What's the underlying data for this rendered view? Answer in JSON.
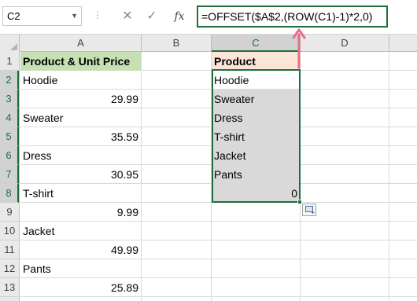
{
  "formula_bar": {
    "name_box": "C2",
    "cancel_icon": "close-icon",
    "enter_icon": "check-icon",
    "function_label": "fx",
    "formula": "=OFFSET($A$2,(ROW(C1)-1)*2,0)"
  },
  "columns": [
    "A",
    "B",
    "C",
    "D"
  ],
  "rows": [
    "1",
    "2",
    "3",
    "4",
    "5",
    "6",
    "7",
    "8",
    "9",
    "10",
    "11",
    "12",
    "13"
  ],
  "sheet": {
    "A": [
      "Product & Unit Price",
      "Hoodie",
      "29.99",
      "Sweater",
      "35.59",
      "Dress",
      "30.95",
      "T-shirt",
      "9.99",
      "Jacket",
      "49.99",
      "Pants",
      "25.89"
    ],
    "C": [
      "Product",
      "Hoodie",
      "Sweater",
      "Dress",
      "T-shirt",
      "Jacket",
      "Pants",
      "0"
    ]
  },
  "colors": {
    "header_a": "#c6e0b4",
    "header_c": "#fce4d6",
    "selection": "#1e6e3c",
    "gray_fill": "#d9d9d9",
    "arrow": "#e86d86"
  }
}
